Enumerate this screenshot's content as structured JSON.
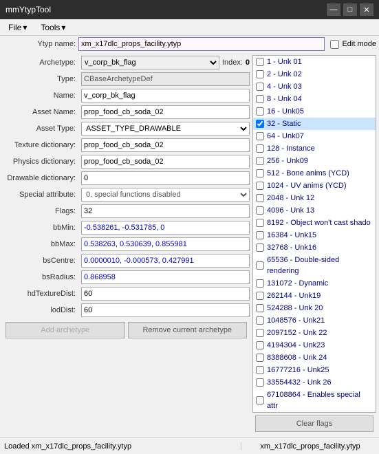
{
  "titleBar": {
    "title": "mmYtypTool",
    "minimizeBtn": "—",
    "maximizeBtn": "□",
    "closeBtn": "✕"
  },
  "menuBar": {
    "file": "File",
    "tools": "Tools"
  },
  "header": {
    "ytypLabel": "Ytyp name:",
    "ytypValue": "xm_x17dlc_props_facility.ytyp",
    "editModeLabel": "Edit mode"
  },
  "form": {
    "archetypeLabel": "Archetype:",
    "archetypeValue": "v_corp_bk_flag",
    "indexLabel": "Index:",
    "indexValue": "0",
    "typeLabel": "Type:",
    "typeValue": "CBaseArchetypeDef",
    "nameLabel": "Name:",
    "nameValue": "v_corp_bk_flag",
    "assetNameLabel": "Asset Name:",
    "assetNameValue": "prop_food_cb_soda_02",
    "assetTypeLabel": "Asset Type:",
    "assetTypeValue": "ASSET_TYPE_DRAWABLE",
    "textureDictLabel": "Texture dictionary:",
    "textureDictValue": "prop_food_cb_soda_02",
    "physicsDictLabel": "Physics dictionary:",
    "physicsDictValue": "prop_food_cb_soda_02",
    "drawableDictLabel": "Drawable dictionary:",
    "drawableDictValue": "0",
    "specialAttrLabel": "Special attribute:",
    "specialAttrValue": "0. special functions disabled",
    "flagsLabel": "Flags:",
    "flagsValue": "32",
    "bbMinLabel": "bbMin:",
    "bbMinValue": "-0.538261, -0.531785, 0",
    "bbMaxLabel": "bbMax:",
    "bbMaxValue": "0.538263, 0.530639, 0.855981",
    "bsCentreLabel": "bsCentre:",
    "bsCentreValue": "0.0000010, -0.000573, 0.427991",
    "bsRadiusLabel": "bsRadius:",
    "bsRadiusValue": "0.868958",
    "hdTexDistLabel": "hdTextureDist:",
    "hdTexDistValue": "60",
    "lodDistLabel": "lodDist:",
    "lodDistValue": "60"
  },
  "buttons": {
    "addArchetype": "Add archetype",
    "removeArchetype": "Remove current archetype"
  },
  "flagsList": [
    {
      "value": 1,
      "label": "1 - Unk 01",
      "checked": false
    },
    {
      "value": 2,
      "label": "2 - Unk 02",
      "checked": false
    },
    {
      "value": 4,
      "label": "4 - Unk 03",
      "checked": false
    },
    {
      "value": 8,
      "label": "8 - Unk 04",
      "checked": false
    },
    {
      "value": 16,
      "label": "16 - Unk05",
      "checked": false
    },
    {
      "value": 32,
      "label": "32 - Static",
      "checked": true
    },
    {
      "value": 64,
      "label": "64 - Unk07",
      "checked": false
    },
    {
      "value": 128,
      "label": "128 - Instance",
      "checked": false
    },
    {
      "value": 256,
      "label": "256 - Unk09",
      "checked": false
    },
    {
      "value": 512,
      "label": "512 - Bone anims (YCD)",
      "checked": false
    },
    {
      "value": 1024,
      "label": "1024 - UV anims (YCD)",
      "checked": false
    },
    {
      "value": 2048,
      "label": "2048 - Unk 12",
      "checked": false
    },
    {
      "value": 4096,
      "label": "4096 - Unk 13",
      "checked": false
    },
    {
      "value": 8192,
      "label": "8192 - Object won't cast shado",
      "checked": false
    },
    {
      "value": 16384,
      "label": "16384 - Unk15",
      "checked": false
    },
    {
      "value": 32768,
      "label": "32768 - Unk16",
      "checked": false
    },
    {
      "value": 65536,
      "label": "65536 - Double-sided rendering",
      "checked": false
    },
    {
      "value": 131072,
      "label": "131072 - Dynamic",
      "checked": false
    },
    {
      "value": 262144,
      "label": "262144 - Unk19",
      "checked": false
    },
    {
      "value": 524288,
      "label": "524288 - Unk 20",
      "checked": false
    },
    {
      "value": 1048576,
      "label": "1048576 - Unk21",
      "checked": false
    },
    {
      "value": 2097152,
      "label": "2097152 - Unk 22",
      "checked": false
    },
    {
      "value": 4194304,
      "label": "4194304 - Unk23",
      "checked": false
    },
    {
      "value": 8388608,
      "label": "8388608 - Unk 24",
      "checked": false
    },
    {
      "value": 16777216,
      "label": "16777216 - Unk25",
      "checked": false
    },
    {
      "value": 33554432,
      "label": "33554432 - Unk 26",
      "checked": false
    },
    {
      "value": 67108864,
      "label": "67108864 - Enables special attr",
      "checked": false
    }
  ],
  "clearFlags": "Clear flags",
  "statusBar": {
    "left": "Loaded xm_x17dlc_props_facility.ytyp",
    "right": "xm_x17dlc_props_facility.ytyp"
  }
}
